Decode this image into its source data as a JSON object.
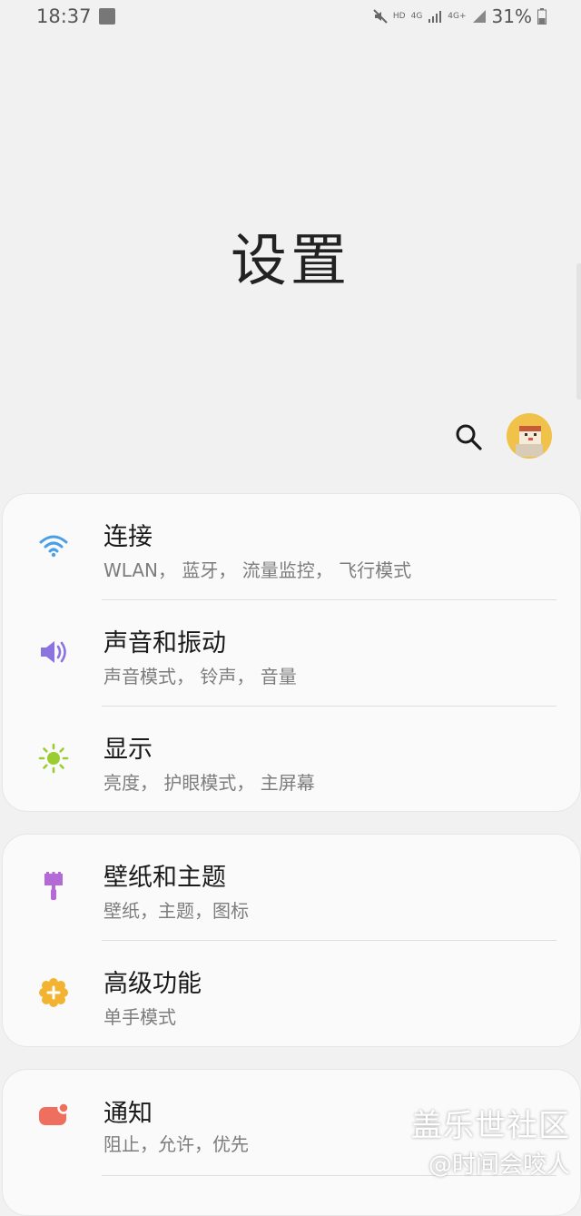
{
  "status_bar": {
    "time": "18:37",
    "hd": "HD",
    "net1": "4G",
    "net2": "4G+",
    "battery": "31%"
  },
  "page_title": "设置",
  "cards": [
    {
      "items": [
        {
          "title": "连接",
          "subtitle": "WLAN， 蓝牙， 流量监控， 飞行模式",
          "icon": "wifi-icon",
          "color": "#4a9fe6"
        },
        {
          "title": "声音和振动",
          "subtitle": "声音模式， 铃声， 音量",
          "icon": "speaker-icon",
          "color": "#8b73e0"
        },
        {
          "title": "显示",
          "subtitle": "亮度， 护眼模式， 主屏幕",
          "icon": "brightness-icon",
          "color": "#9acd32"
        }
      ]
    },
    {
      "items": [
        {
          "title": "壁纸和主题",
          "subtitle": "壁纸，主题，图标",
          "icon": "brush-icon",
          "color": "#b36ad6"
        },
        {
          "title": "高级功能",
          "subtitle": "单手模式",
          "icon": "gear-plus-icon",
          "color": "#f2b430"
        }
      ]
    },
    {
      "items": [
        {
          "title": "通知",
          "subtitle": "阻止，允许，优先",
          "icon": "notification-icon",
          "color": "#ef6f5f"
        }
      ]
    }
  ],
  "watermark": {
    "line1": "盖乐世社区",
    "line2": "@时间会咬人"
  }
}
